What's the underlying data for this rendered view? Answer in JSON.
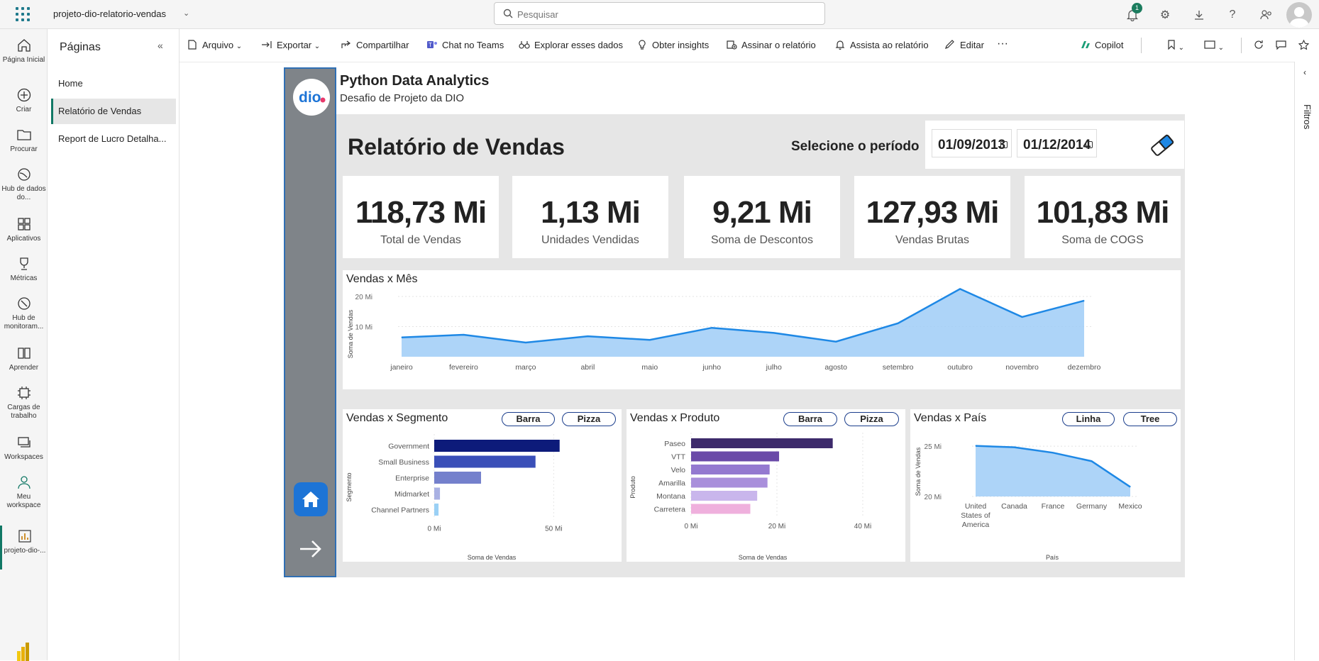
{
  "topbar": {
    "workspace_title": "projeto-dio-relatorio-vendas",
    "search_placeholder": "Pesquisar",
    "notifications_count": "1"
  },
  "leftnav": {
    "items": [
      {
        "label": "Página Inicial",
        "icon": "home-icon"
      },
      {
        "label": "Criar",
        "icon": "plus-circle-icon"
      },
      {
        "label": "Procurar",
        "icon": "folder-icon"
      },
      {
        "label": "Hub de dados do...",
        "icon": "data-hub-icon"
      },
      {
        "label": "Aplicativos",
        "icon": "apps-icon"
      },
      {
        "label": "Métricas",
        "icon": "trophy-icon"
      },
      {
        "label": "Hub de monitoram...",
        "icon": "monitor-hub-icon"
      },
      {
        "label": "Aprender",
        "icon": "book-icon"
      },
      {
        "label": "Cargas de trabalho",
        "icon": "workloads-icon"
      },
      {
        "label": "Workspaces",
        "icon": "workspaces-icon"
      },
      {
        "label": "Meu workspace",
        "icon": "person-icon"
      },
      {
        "label": "projeto-dio-...",
        "icon": "report-icon"
      }
    ]
  },
  "pages": {
    "title": "Páginas",
    "items": [
      "Home",
      "Relatório de Vendas",
      "Report de Lucro Detalha..."
    ],
    "selected": "Relatório de Vendas"
  },
  "commandbar": {
    "arquivo": "Arquivo",
    "exportar": "Exportar",
    "compartilhar": "Compartilhar",
    "teams": "Chat no Teams",
    "explorar": "Explorar esses dados",
    "insights": "Obter insights",
    "assinar": "Assinar o relatório",
    "assista": "Assista ao relatório",
    "editar": "Editar",
    "more": "···",
    "copilot": "Copilot"
  },
  "filters_label": "Filtros",
  "report": {
    "header_title": "Python Data Analytics",
    "header_subtitle": "Desafio de Projeto da DIO",
    "title": "Relatório de Vendas",
    "period_label": "Selecione o período",
    "date_start": "01/09/2013",
    "date_end": "01/12/2014",
    "kpis": [
      {
        "value": "118,73 Mi",
        "label": "Total de Vendas"
      },
      {
        "value": "1,13 Mi",
        "label": "Unidades Vendidas"
      },
      {
        "value": "9,21 Mi",
        "label": "Soma de Descontos"
      },
      {
        "value": "127,93 Mi",
        "label": "Vendas Brutas"
      },
      {
        "value": "101,83 Mi",
        "label": "Soma de COGS"
      }
    ],
    "brand_color": "#1d74d6"
  },
  "chart_data": [
    {
      "type": "area",
      "title": "Vendas x Mês",
      "xlabel": "",
      "ylabel": "Soma de Vendas",
      "categories": [
        "janeiro",
        "fevereiro",
        "março",
        "abril",
        "maio",
        "junho",
        "julho",
        "agosto",
        "setembro",
        "outubro",
        "novembro",
        "dezembro"
      ],
      "values": [
        6.4,
        7.3,
        4.7,
        6.8,
        5.6,
        9.6,
        7.9,
        5.0,
        11.1,
        22.5,
        13.2,
        18.6
      ],
      "yticks": [
        "10 Mi",
        "20 Mi"
      ],
      "ylim": [
        0,
        24
      ],
      "color": "#1e88e5"
    },
    {
      "type": "bar",
      "title": "Vendas x Segmento",
      "toggles": [
        "Barra",
        "Pizza"
      ],
      "xlabel": "Soma de Vendas",
      "ylabel": "Segmento",
      "categories": [
        "Government",
        "Small Business",
        "Enterprise",
        "Midmarket",
        "Channel Partners"
      ],
      "values": [
        52.5,
        42.4,
        19.6,
        2.4,
        1.8
      ],
      "xticks": [
        "0 Mi",
        "50 Mi"
      ],
      "xlim": [
        0,
        60
      ],
      "colors": [
        "#0d1b7a",
        "#3a4fb8",
        "#7480cc",
        "#a9b1e3",
        "#9ad0f5"
      ]
    },
    {
      "type": "bar",
      "title": "Vendas x Produto",
      "toggles": [
        "Barra",
        "Pizza"
      ],
      "xlabel": "Soma de Vendas",
      "ylabel": "Produto",
      "categories": [
        "Paseo",
        "VTT",
        "Velo",
        "Amarilla",
        "Montana",
        "Carretera"
      ],
      "values": [
        33.0,
        20.5,
        18.3,
        17.8,
        15.4,
        13.8
      ],
      "xticks": [
        "0 Mi",
        "20 Mi",
        "40 Mi"
      ],
      "xlim": [
        0,
        40
      ],
      "colors": [
        "#3d2a6b",
        "#6a4aa8",
        "#9479d0",
        "#a98fdb",
        "#c9b6ec",
        "#efb0dd"
      ]
    },
    {
      "type": "area",
      "title": "Vendas x País",
      "toggles": [
        "Linha",
        "Tree"
      ],
      "xlabel": "País",
      "ylabel": "Soma de Vendas",
      "categories": [
        "United States of America",
        "Canada",
        "France",
        "Germany",
        "Mexico"
      ],
      "values": [
        25.03,
        24.89,
        24.35,
        23.51,
        20.95
      ],
      "yticks": [
        "20 Mi",
        "25 Mi"
      ],
      "ylim": [
        20,
        25.5
      ],
      "color": "#1e88e5"
    }
  ]
}
